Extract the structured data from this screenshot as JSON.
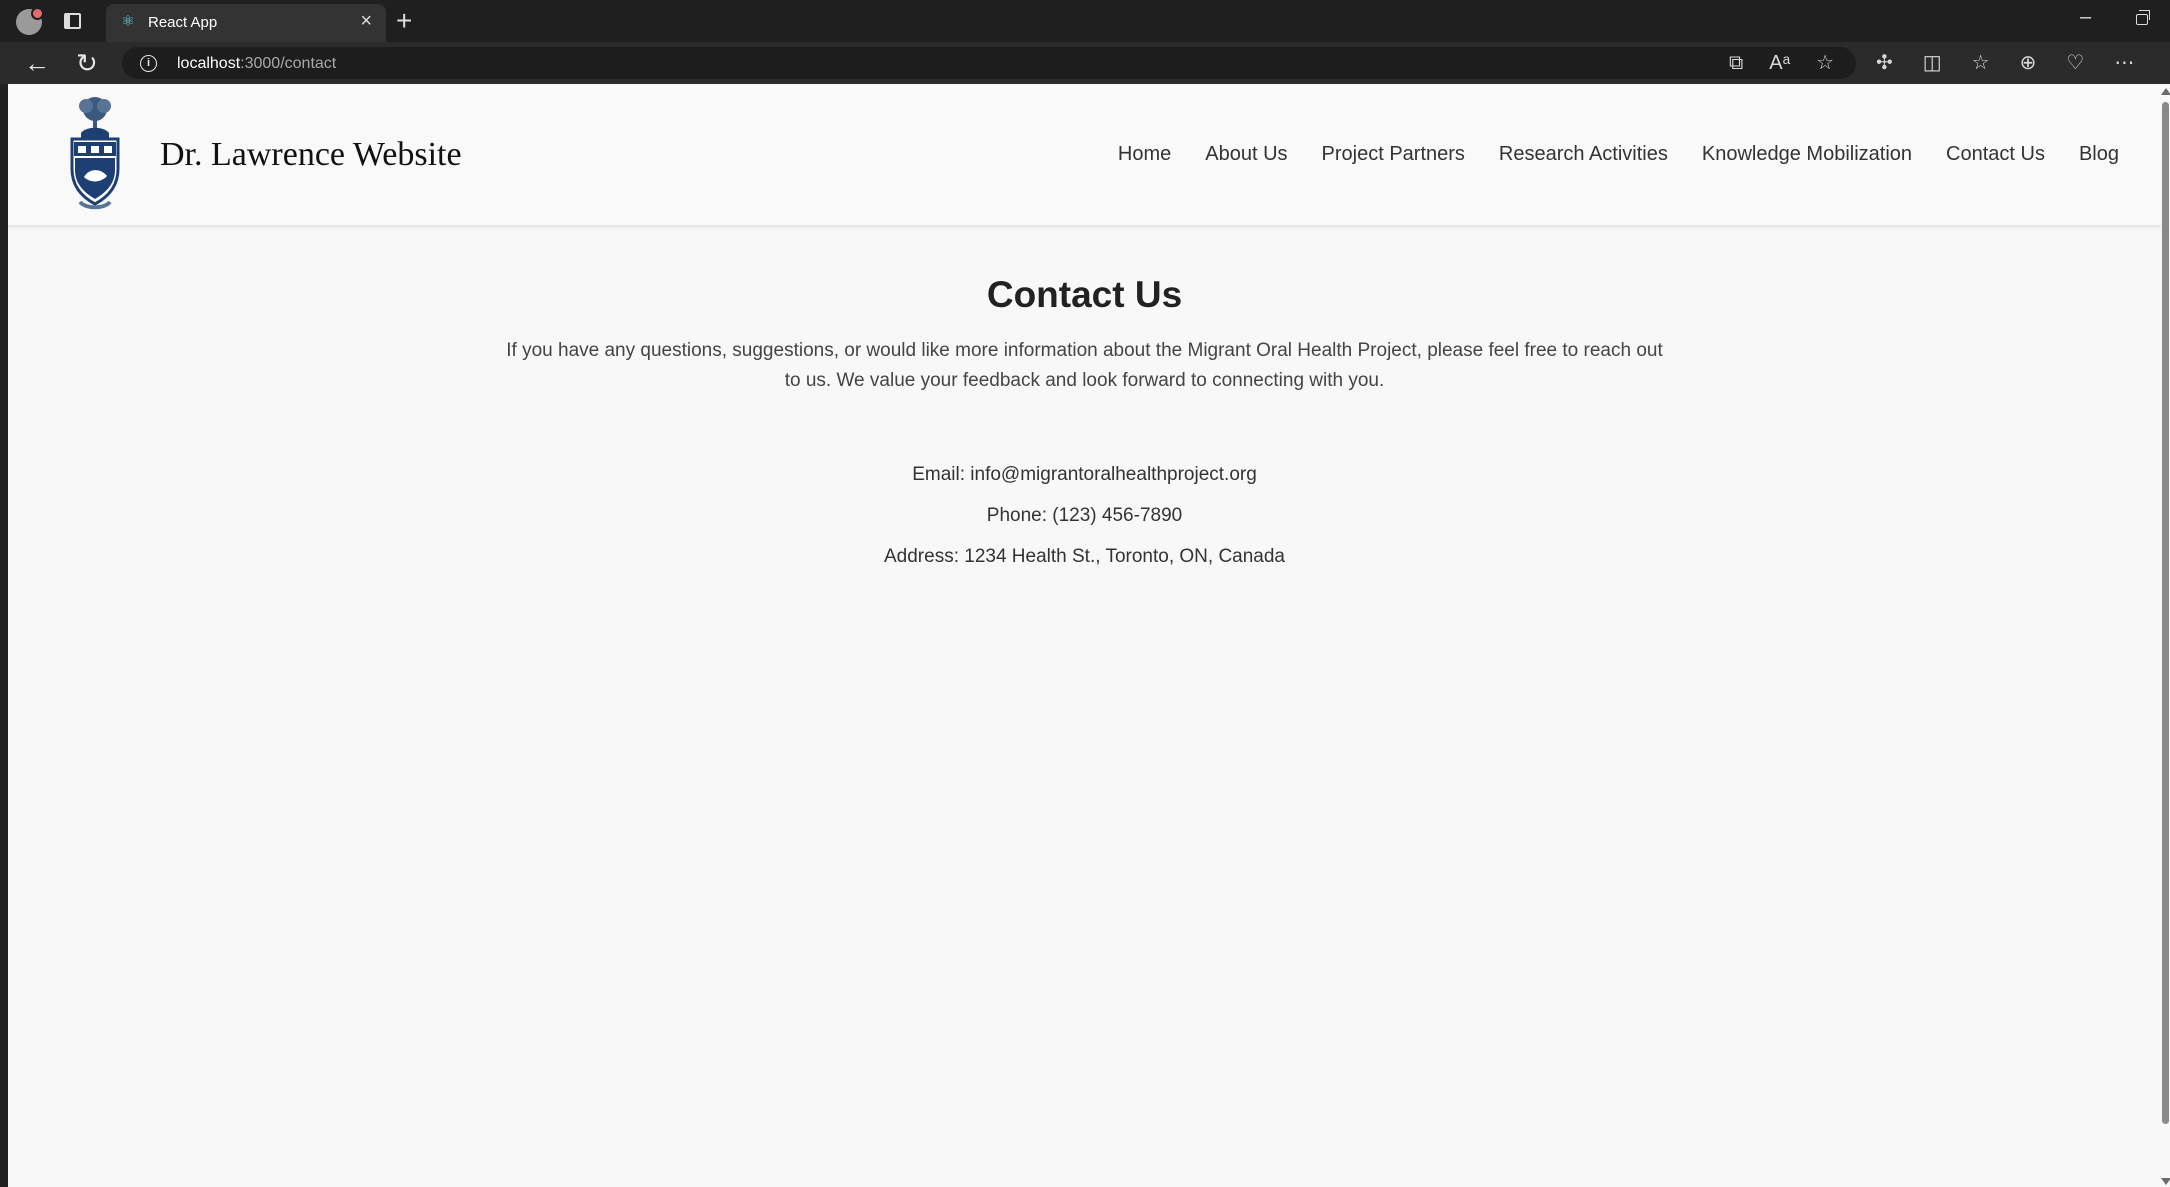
{
  "browser": {
    "tab_title": "React App",
    "tab_close": "×",
    "new_tab": "+",
    "url_host": "localhost",
    "url_rest": ":3000/contact",
    "window_minimize": "–",
    "icons": [
      "profile-icon",
      "tab-actions-icon",
      "react-icon",
      "back-icon",
      "reload-icon",
      "site-info-icon",
      "open-in-app-icon",
      "read-aloud-icon",
      "favorite-icon",
      "extensions-icon",
      "split-screen-icon",
      "favorites-icon",
      "collections-icon",
      "browser-essentials-icon",
      "more-icon"
    ]
  },
  "site": {
    "title": "Dr. Lawrence Website",
    "nav": [
      {
        "label": "Home"
      },
      {
        "label": "About Us"
      },
      {
        "label": "Project Partners"
      },
      {
        "label": "Research Activities"
      },
      {
        "label": "Knowledge Mobilization"
      },
      {
        "label": "Contact Us"
      },
      {
        "label": "Blog"
      }
    ],
    "colors": {
      "page": "#f8f8f8",
      "logo_blue": "#1d3f73"
    }
  },
  "contact": {
    "heading": "Contact Us",
    "intro": "If you have any questions, suggestions, or would like more information about the Migrant Oral Health Project, please feel free to reach out to us. We value your feedback and look forward to connecting with you.",
    "email": "Email: info@migrantoralhealthproject.org",
    "phone": "Phone: (123) 456-7890",
    "address": "Address: 1234 Health St., Toronto, ON, Canada"
  }
}
